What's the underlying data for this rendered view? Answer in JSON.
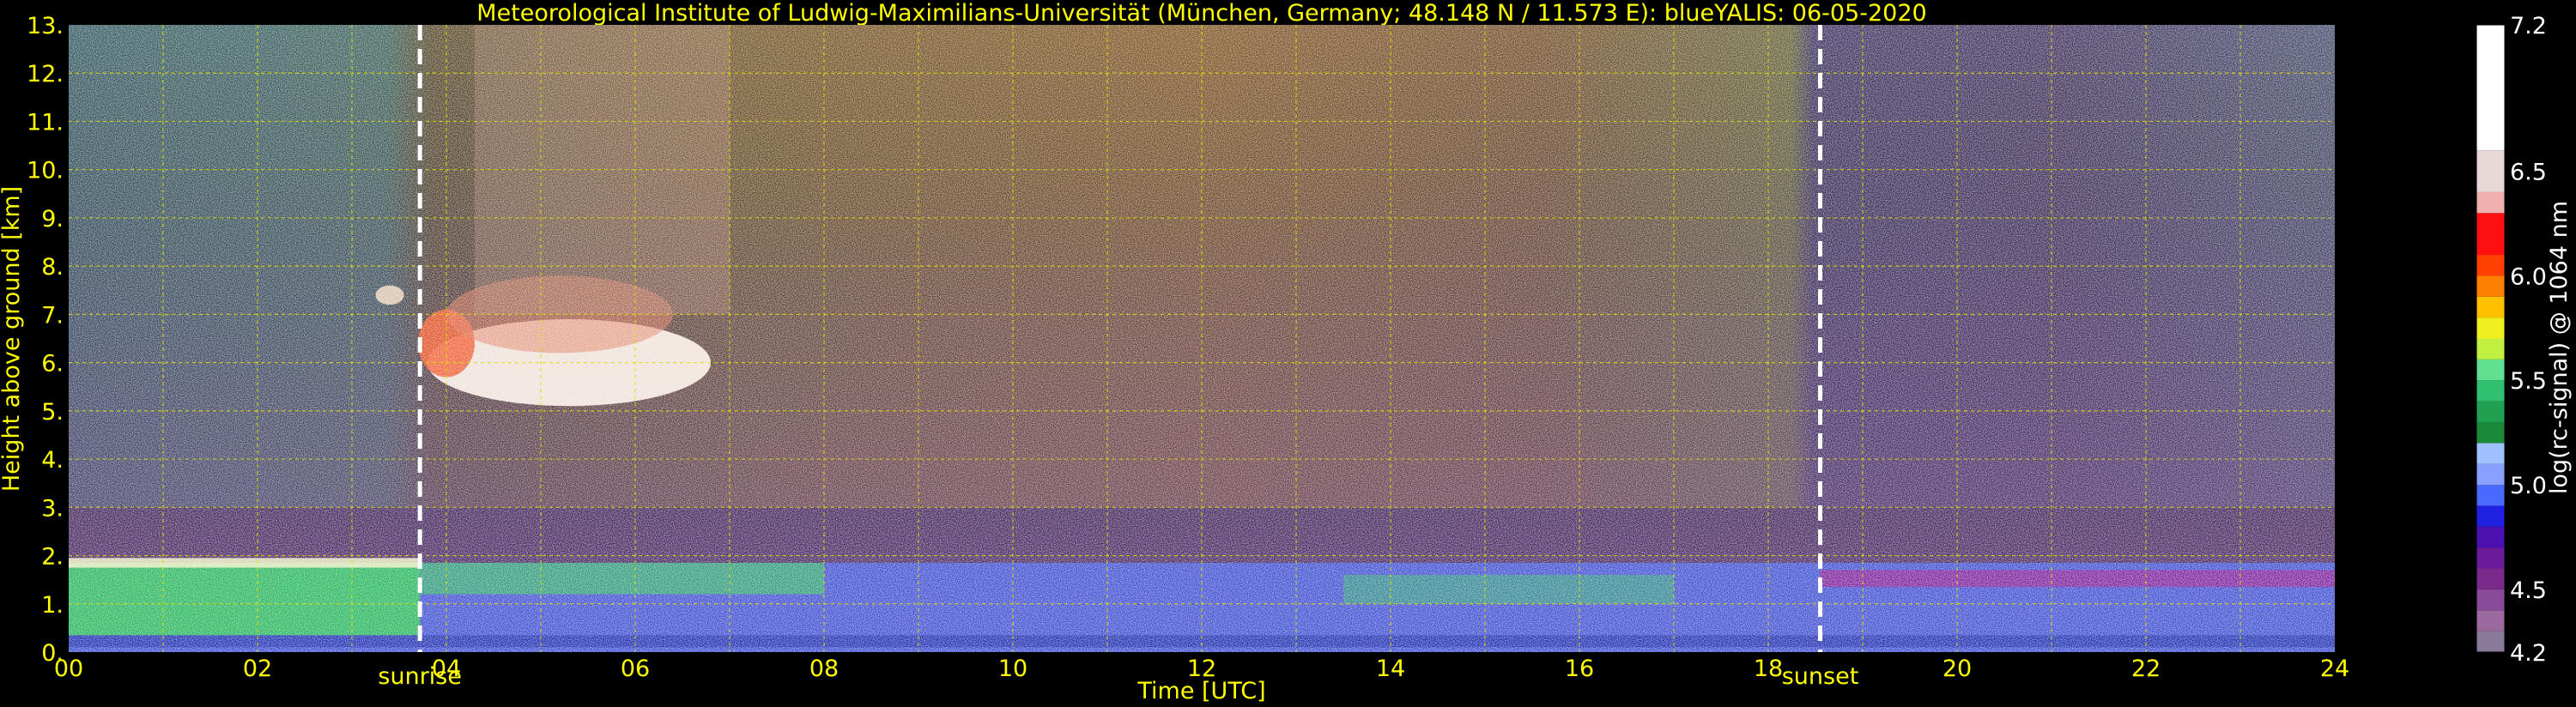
{
  "chart_data": {
    "type": "heatmap",
    "title": "Meteorological Institute of Ludwig-Maximilians-Universität (München, Germany; 48.148 N / 11.573 E):    blueYALIS: 06-05-2020",
    "xlabel": "Time [UTC]",
    "ylabel": "Height above ground [km]",
    "xlim": [
      0,
      24
    ],
    "ylim": [
      0,
      13
    ],
    "x_ticks": [
      "00",
      "02",
      "04",
      "06",
      "08",
      "10",
      "12",
      "14",
      "16",
      "18",
      "20",
      "22",
      "24"
    ],
    "y_ticks": [
      "0.",
      "1.",
      "2.",
      "3.",
      "4.",
      "5.",
      "6.",
      "7.",
      "8.",
      "9.",
      "10.",
      "11.",
      "12.",
      "13."
    ],
    "grid": true,
    "markers": [
      {
        "label": "sunrise",
        "x": 3.72
      },
      {
        "label": "sunset",
        "x": 18.55
      }
    ],
    "colorbar": {
      "label": "log(rc-signal) @ 1064 nm",
      "ticks": [
        "4.2",
        "4.5",
        "5.0",
        "5.5",
        "6.0",
        "6.5",
        "7.2"
      ],
      "min": 4.2,
      "max": 7.2
    }
  }
}
